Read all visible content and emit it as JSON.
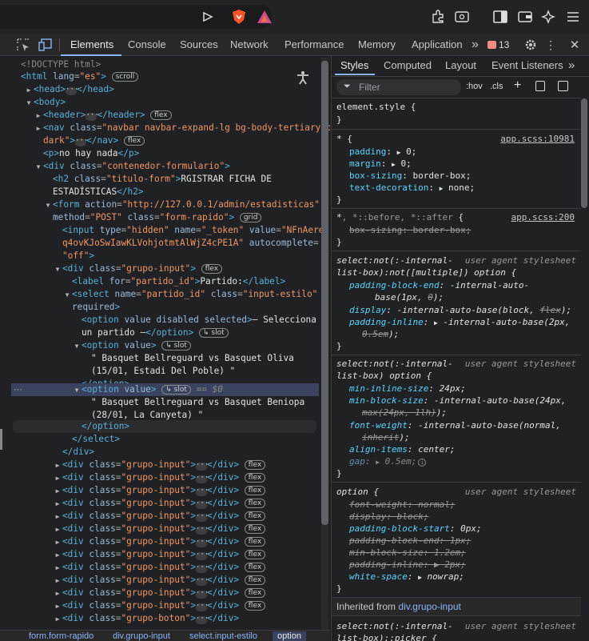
{
  "browser": {
    "icons": [
      "share-icon",
      "brave-shields-icon",
      "brave-rewards-icon",
      "extensions-icon",
      "tab-search-icon",
      "sidebar-icon",
      "wallet-icon",
      "leo-icon",
      "menu-icon"
    ]
  },
  "devtools": {
    "tabs": [
      "Elements",
      "Console",
      "Sources",
      "Network",
      "Performance",
      "Memory",
      "Application"
    ],
    "more": "»",
    "issues_count": "13",
    "styles_tabs": [
      "Styles",
      "Computed",
      "Layout",
      "Event Listeners"
    ],
    "filter_placeholder": "Filter",
    "hov": ":hov",
    "cls": ".cls"
  },
  "dom": {
    "doctype": "<!DOCTYPE html>",
    "html_attr_val": "\"es\"",
    "badge_scroll": "scroll",
    "badge_flex": "flex",
    "badge_grid": "grid",
    "badge_slot": "slot",
    "p_text": "no hay nada",
    "nav_class": "\"navbar navbar-expand-lg bg-body-tertiary bg-",
    "nav_class2": "dark\"",
    "div_class": "\"contenedor-formulario\"",
    "h2_class": "\"titulo-form\"",
    "h2_text1": "RGISTRAR FICHA DE",
    "h2_text2": "ESTADÍSTICAS",
    "form_action": "\"http://127.0.0.1/admin/estadisticas\"",
    "form_method": "\"POST\"",
    "form_class": "\"form-rapido\"",
    "input_type": "\"hidden\"",
    "input_name": "\"_token\"",
    "input_value": "\"NFnAere",
    "input_value2": "q4ovKJoSwIawKLVohjotmtAlWjZ4cPE1A\"",
    "input_ac": "\"off\"",
    "grupo_input": "\"grupo-input\"",
    "grupo_boton": "\"grupo-boton\"",
    "label_for": "\"partido_id\"",
    "label_text": "Partido:",
    "select_name": "\"partido_id\"",
    "select_class": "\"input-estilo\"",
    "opt0_text1": "— Selecciona",
    "opt0_text2": "un partido —",
    "opt1_text1": "\" Basquet Bellreguard vs Basquet Oliva",
    "opt1_text2": "(15/01, Estadi Del Poble) \"",
    "opt2_text1": "\" Basquet Bellreguard vs Basquet Beniopa",
    "opt2_text2": "(28/01, La Canyeta) \"",
    "dollar0": "== $0"
  },
  "crumbs": [
    "form.form-rapido",
    "div.grupo-input",
    "select.input-estilo",
    "option"
  ],
  "styles": {
    "element_style": "element.style {",
    "star_src": "app.scss:10981",
    "before_after_src": "app.scss:200",
    "ua": "user agent stylesheet",
    "inherited_label": "Inherited from",
    "inherited_from": "div.grupo-input"
  }
}
